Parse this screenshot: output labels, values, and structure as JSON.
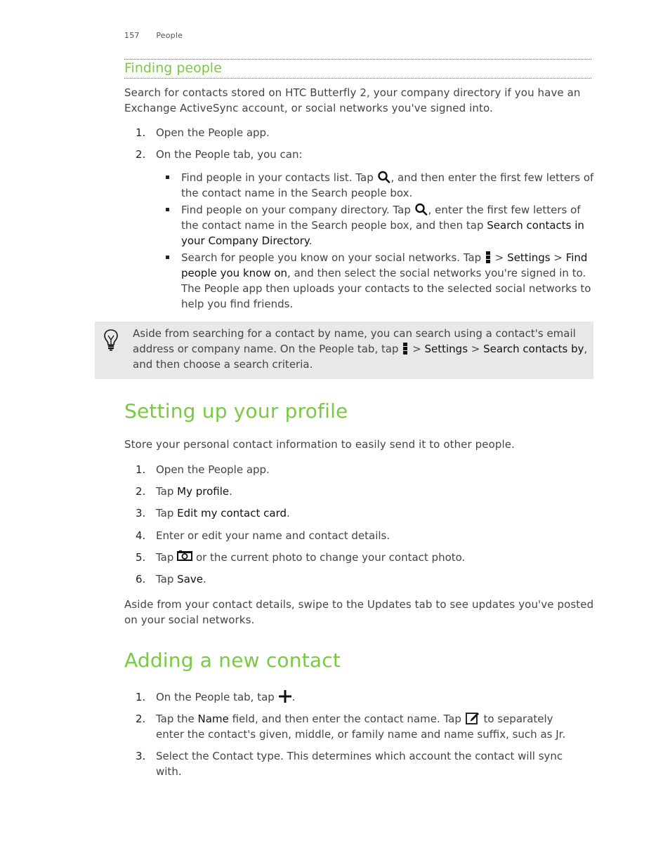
{
  "header": {
    "page_number": "157",
    "chapter": "People"
  },
  "finding_people": {
    "title": "Finding people",
    "intro": "Search for contacts stored on HTC Butterfly 2, your company directory if you have an Exchange ActiveSync account, or social networks you've signed into.",
    "steps": [
      {
        "num": "1.",
        "text": "Open the People app."
      },
      {
        "num": "2.",
        "text": "On the People tab, you can:"
      }
    ],
    "bullets": {
      "b1_a": "Find people in your contacts list. Tap",
      "b1_b": ", and then enter the first few letters of the contact name in the Search people box.",
      "b2_a": "Find people on your company directory. Tap",
      "b2_b": ", enter the first few letters of the contact name in the Search people box, and then tap",
      "b2_em": "Search contacts in your Company Directory",
      "b2_end": ".",
      "b3_a": "Search for people you know on your social networks. Tap",
      "b3_sep1": " > ",
      "b3_em1": "Settings",
      "b3_sep2": " > ",
      "b3_em2": "Find people you know on",
      "b3_b": ", and then select the social networks you're signed in to. The People app then uploads your contacts to the selected social networks to help you find friends."
    },
    "tip": {
      "a": "Aside from searching for a contact by name, you can search using a contact's email address or company name. On the People tab, tap",
      "sep1": " > ",
      "em1": "Settings",
      "sep2": " > ",
      "em2": "Search contacts by",
      "b": ", and then choose a search criteria."
    }
  },
  "profile": {
    "title": "Setting up your profile",
    "intro": "Store your personal contact information to easily send it to other people.",
    "steps": [
      {
        "num": "1.",
        "text": "Open the People app."
      },
      {
        "num": "2.",
        "pre": "Tap ",
        "em": "My profile",
        "post": "."
      },
      {
        "num": "3.",
        "pre": "Tap ",
        "em": "Edit my contact card",
        "post": "."
      },
      {
        "num": "4.",
        "text": "Enter or edit your name and contact details."
      },
      {
        "num": "5.",
        "pre": "Tap ",
        "post": " or the current photo to change your contact photo."
      },
      {
        "num": "6.",
        "pre": "Tap ",
        "em": "Save",
        "post": "."
      }
    ],
    "outro": "Aside from your contact details, swipe to the Updates tab to see updates you've posted on your social networks."
  },
  "new_contact": {
    "title": "Adding a new contact",
    "steps": [
      {
        "num": "1.",
        "pre": "On the People tab, tap ",
        "post": "."
      },
      {
        "num": "2.",
        "pre": "Tap the ",
        "em": "Name",
        "mid": " field, and then enter the contact name. Tap ",
        "post": " to separately enter the contact's given, middle, or family name and name suffix, such as Jr."
      },
      {
        "num": "3.",
        "text": "Select the Contact type. This determines which account the contact will sync with."
      }
    ]
  },
  "colors": {
    "heading_green": "#7ac943",
    "tip_background": "#e8e8e8",
    "body_text": "#444444"
  },
  "icons": [
    "search-icon",
    "menu-icon",
    "lightbulb-icon",
    "camera-icon",
    "plus-icon",
    "edit-icon"
  ]
}
